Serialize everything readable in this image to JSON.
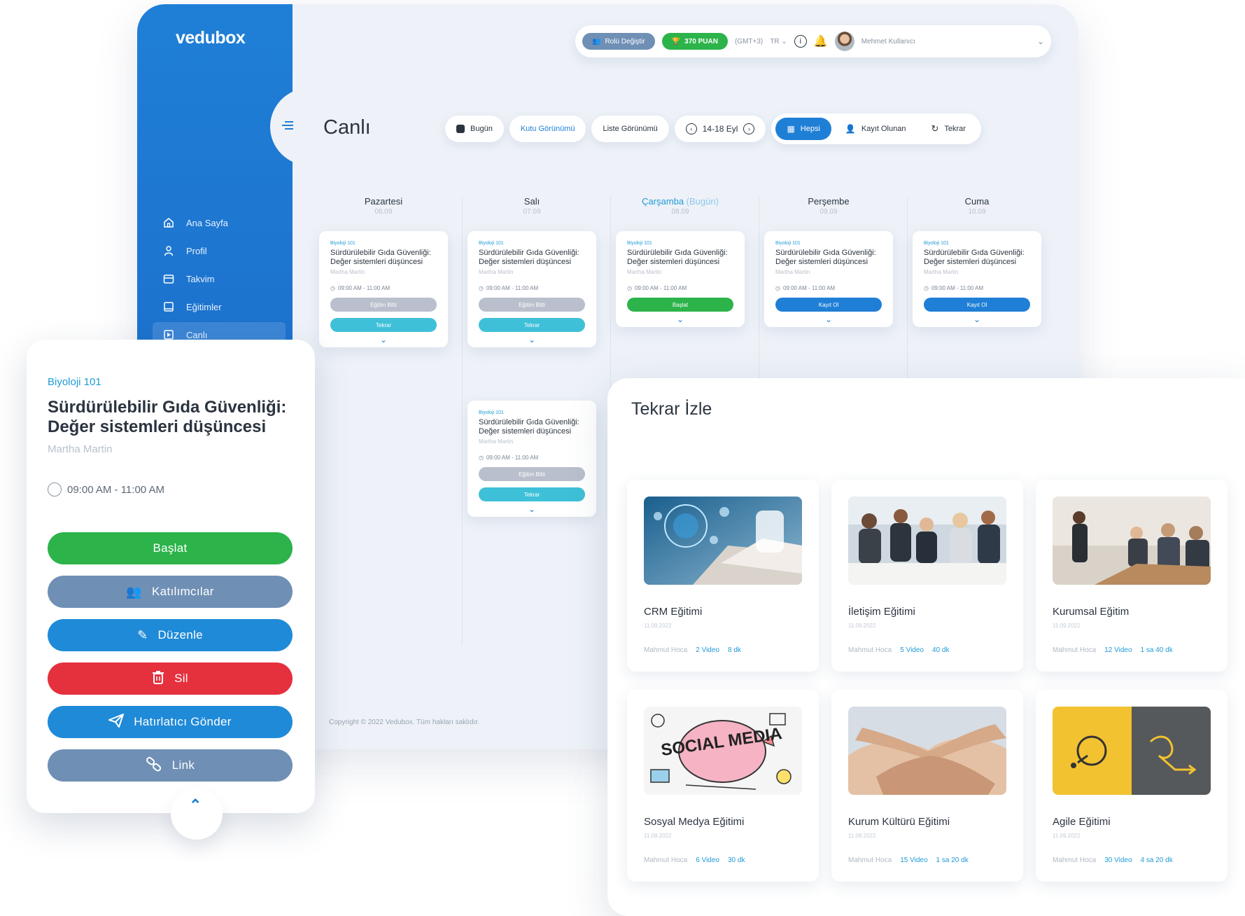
{
  "app": {
    "logo": "vedubox"
  },
  "sidebar": {
    "items": [
      {
        "label": "Ana Sayfa",
        "icon": "home-icon"
      },
      {
        "label": "Profil",
        "icon": "user-icon"
      },
      {
        "label": "Takvim",
        "icon": "calendar-icon"
      },
      {
        "label": "Eğitimler",
        "icon": "book-icon"
      },
      {
        "label": "Canlı",
        "icon": "live-icon",
        "active": true
      }
    ]
  },
  "topbar": {
    "role_button": "Rolü Değiştir",
    "points": "370 PUAN",
    "timezone": "(GMT+3)",
    "language": "TR",
    "user_name": "Mehmet Kullanıcı"
  },
  "page": {
    "title": "Canlı",
    "toolbar": {
      "today": "Bugün",
      "box_view": "Kutu Görünümü",
      "list_view": "Liste Görünümü",
      "date_range": "14-18 Eyl"
    },
    "filters": {
      "all": "Hepsi",
      "registered": "Kayıt Olunan",
      "replay": "Tekrar"
    }
  },
  "week": {
    "days": [
      {
        "name": "Pazartesi",
        "date": "06.09"
      },
      {
        "name": "Salı",
        "date": "07.09"
      },
      {
        "name": "Çarşamba",
        "today_suffix": "(Bugün)",
        "date": "08.09"
      },
      {
        "name": "Perşembe",
        "date": "09.09"
      },
      {
        "name": "Cuma",
        "date": "10.09"
      }
    ],
    "events": [
      {
        "course": "Biyoloji 101",
        "title": "Sürdürülebilir Gıda Güvenliği: Değer sistemleri düşüncesi",
        "teacher": "Martha Martin",
        "time": "09:00 AM - 11:00 AM",
        "buttons": [
          "Eğitim Bitti",
          "Tekrar"
        ]
      },
      {
        "course": "Biyoloji 101",
        "title": "Sürdürülebilir Gıda Güvenliği: Değer sistemleri düşüncesi",
        "teacher": "Martha Martin",
        "time": "09:00 AM - 11:00 AM",
        "buttons": [
          "Eğitim Bitti",
          "Tekrar"
        ]
      },
      {
        "course": "Biyoloji 101",
        "title": "Sürdürülebilir Gıda Güvenliği: Değer sistemleri düşüncesi",
        "teacher": "Martha Martin",
        "time": "09:00 AM - 11:00 AM",
        "buttons": [
          "Başlat"
        ]
      },
      {
        "course": "Biyoloji 101",
        "title": "Sürdürülebilir Gıda Güvenliği: Değer sistemleri düşüncesi",
        "teacher": "Martha Martin",
        "time": "09:00 AM - 11:00 AM",
        "buttons": [
          "Kayıt Ol"
        ]
      },
      {
        "course": "Biyoloji 101",
        "title": "Sürdürülebilir Gıda Güvenliği: Değer sistemleri düşüncesi",
        "teacher": "Martha Martin",
        "time": "09:00 AM - 11:00 AM",
        "buttons": [
          "Kayıt Ol"
        ]
      },
      {
        "course": "Biyoloji 101",
        "title": "Sürdürülebilir Gıda Güvenliği: Değer sistemleri düşüncesi",
        "teacher": "Martha Martin",
        "time": "09:00 AM - 11:00 AM",
        "buttons": [
          "Eğitim Bitti",
          "Tekrar"
        ]
      }
    ]
  },
  "footer": {
    "copyright": "Copyright © 2022 Vedubox. Tüm hakları saklıdır."
  },
  "detail": {
    "course": "Biyoloji 101",
    "title": "Sürdürülebilir Gıda Güvenliği: Değer sistemleri düşüncesi",
    "teacher": "Martha Martin",
    "time": "09:00 AM - 11:00 AM",
    "buttons": {
      "start": "Başlat",
      "participants": "Katılımcılar",
      "edit": "Düzenle",
      "delete": "Sil",
      "reminder": "Hatırlatıcı Gönder",
      "link": "Link"
    }
  },
  "replay": {
    "title": "Tekrar İzle",
    "videos": [
      {
        "title": "CRM Eğitimi",
        "date": "11.09.2022",
        "teacher": "Mahmut Hoca",
        "videos": "2 Video",
        "duration": "8 dk"
      },
      {
        "title": "İletişim Eğitimi",
        "date": "11.09.2022",
        "teacher": "Mahmut Hoca",
        "videos": "5 Video",
        "duration": "40 dk"
      },
      {
        "title": "Kurumsal Eğitim",
        "date": "11.09.2022",
        "teacher": "Mahmut Hoca",
        "videos": "12 Video",
        "duration": "1 sa 40 dk"
      },
      {
        "title": "Sosyal Medya Eğitimi",
        "date": "11.09.2022",
        "teacher": "Mahmut Hoca",
        "videos": "6 Video",
        "duration": "30 dk"
      },
      {
        "title": "Kurum Kültürü Eğitimi",
        "date": "11.09.2022",
        "teacher": "Mahmut Hoca",
        "videos": "15 Video",
        "duration": "1 sa 20 dk"
      },
      {
        "title": "Agile Eğitimi",
        "date": "11.09.2022",
        "teacher": "Mahmut Hoca",
        "videos": "30 Video",
        "duration": "4 sa 20 dk"
      }
    ],
    "social_media_text": "SOCIAL MEDIA"
  },
  "colors": {
    "primary": "#1f7fd6",
    "green": "#2cb34a",
    "grey_button": "#6f8fb5",
    "red": "#e5303e",
    "cyan": "#3ec0d8",
    "disabled": "#b9bfcc",
    "agile_yellow": "#f2c230",
    "agile_dark": "#55595c"
  }
}
